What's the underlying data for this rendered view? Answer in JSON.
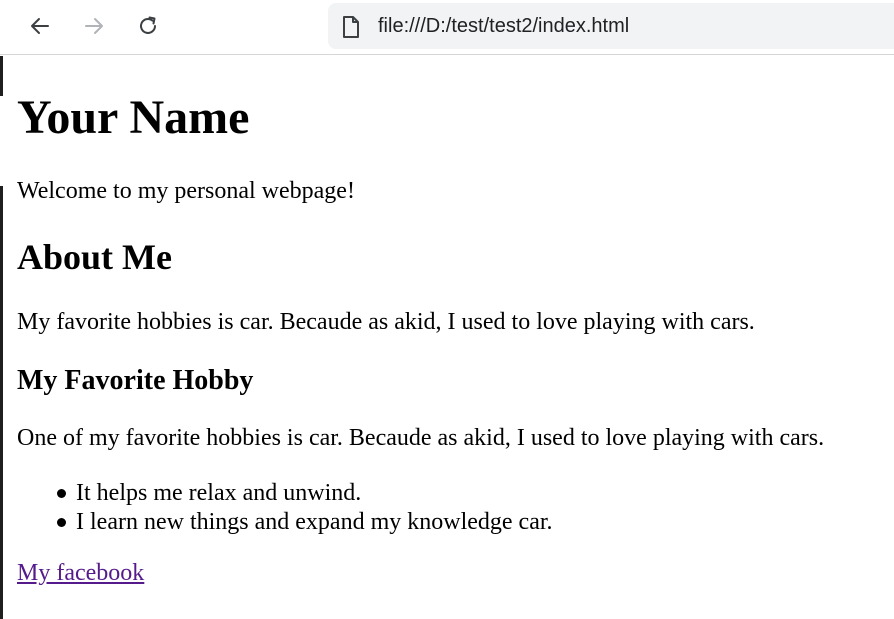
{
  "browser": {
    "url": "file:///D:/test/test2/index.html",
    "icons": {
      "back": "arrow-left-icon",
      "forward": "arrow-right-icon",
      "reload": "reload-icon",
      "page": "file-icon"
    }
  },
  "page": {
    "title": "Your Name",
    "welcome": "Welcome to my personal webpage!",
    "about_heading": "About Me",
    "about_text": "My favorite hobbies is car. Becaude as akid, I used to love playing with cars.",
    "hobby_heading": "My Favorite Hobby",
    "hobby_text": "One of my favorite hobbies is car. Becaude as akid, I used to love playing with cars.",
    "hobby_points": [
      "It helps me relax and unwind.",
      "I learn new things and expand my knowledge car."
    ],
    "link_text": "My facebook",
    "colors": {
      "link_visited": "#551a8b",
      "text": "#000000",
      "address_bar_bg": "#f1f3f4"
    }
  }
}
